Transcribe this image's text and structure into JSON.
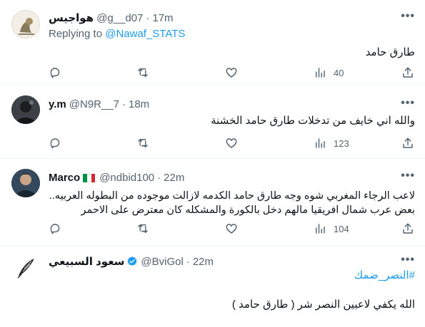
{
  "tweets": [
    {
      "name": "هواجيس",
      "handle": "@g__d07",
      "time": "17m",
      "replying_prefix": "Replying to",
      "replying_to": "@Nawaf_STATS",
      "lines": [
        "طارق حامد"
      ],
      "views": "40"
    },
    {
      "name": "y.m",
      "handle": "@N9R__7",
      "time": "18m",
      "lines": [
        "والله اني خايف من تدخلات طارق حامد الخشنة"
      ],
      "views": "123"
    },
    {
      "name": "Marco",
      "handle": "@ndbid100",
      "time": "22m",
      "lines": [
        "لاعب الرجاء المغربي شوه وجه طارق حامد الكدمه لازالت موجوده من البطوله العربيه..",
        "بعض عرب شمال افريقيا مالهم دخل بالكورة والمشكله كان معترض على الاحمر"
      ],
      "views": "104"
    },
    {
      "name": "سعود السبيعي",
      "handle": "@BviGol",
      "time": "22m",
      "hashtag": "#النصر_ضمك",
      "lines": [
        "الله يكفي لاعبين النصر شر ( طارق حامد )"
      ]
    }
  ],
  "separator": "·",
  "more_icon": "•••",
  "colors": {
    "link": "#1d9bf0",
    "secondary": "#536471",
    "text": "#0f1419",
    "divider": "#eff3f4",
    "verified": "#1d9bf0"
  },
  "flag_colors": [
    "#009246",
    "#ffffff",
    "#ce2b37"
  ]
}
